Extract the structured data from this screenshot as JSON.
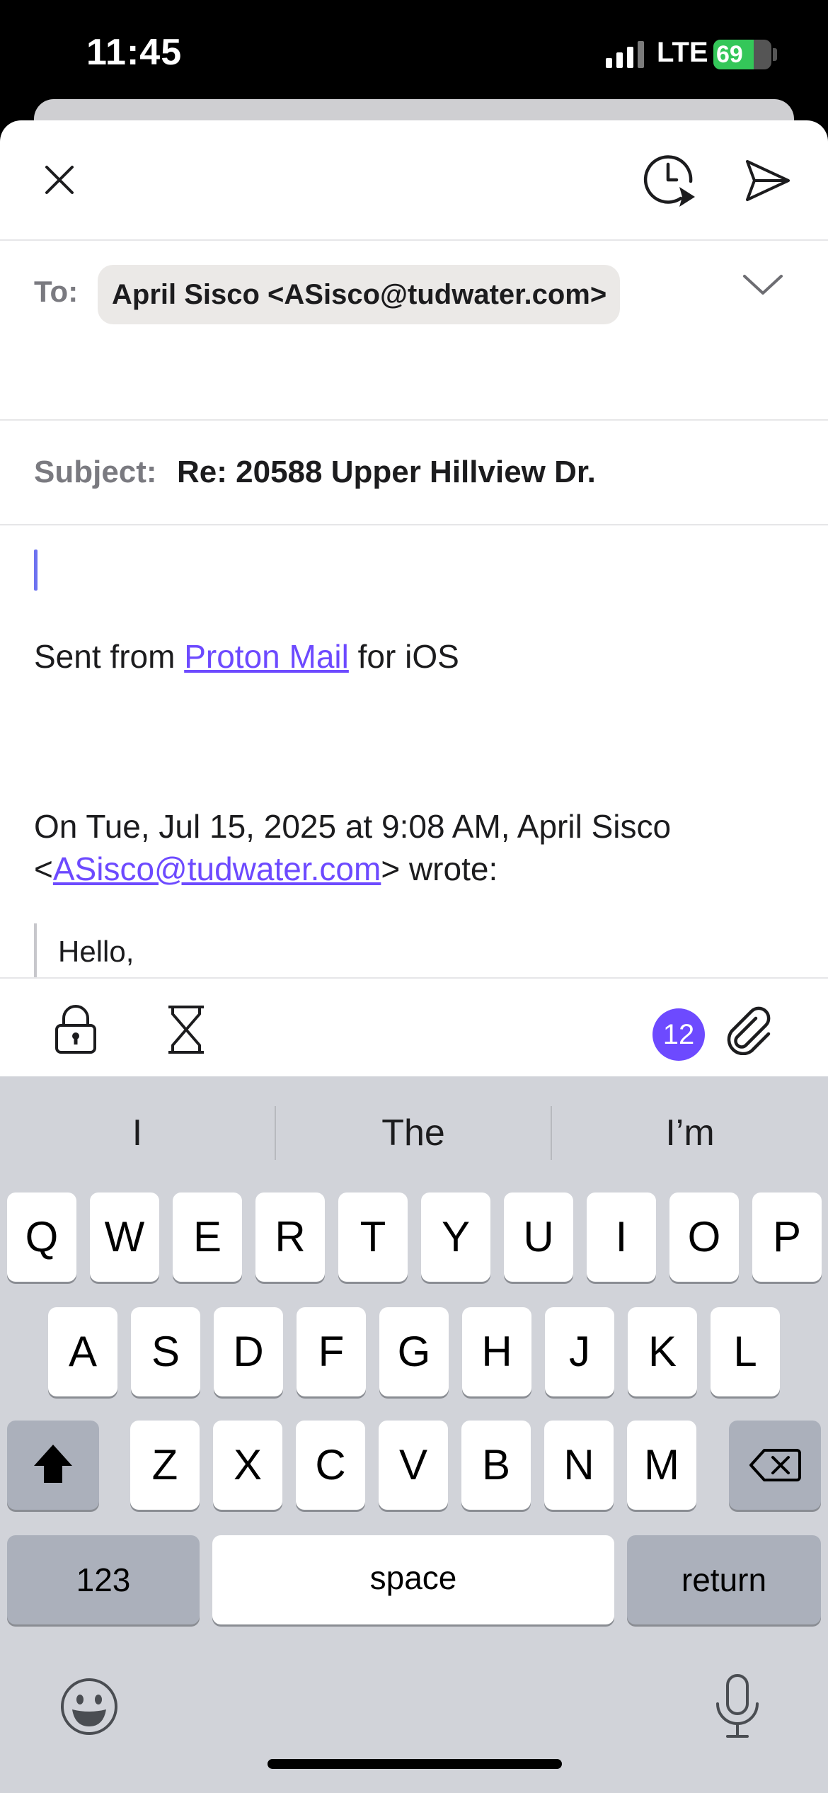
{
  "status_bar": {
    "time": "11:45",
    "network": "LTE",
    "battery": "69",
    "battery_level_percent": 69
  },
  "compose": {
    "to_label": "To:",
    "recipient": "April Sisco <ASisco@tudwater.com>",
    "subject_label": "Subject:",
    "subject": "Re: 20588 Upper Hillview Dr.",
    "signature_prefix": "Sent from ",
    "signature_link": "Proton Mail",
    "signature_suffix": " for iOS",
    "quote_header_line1": "On Tue, Jul 15, 2025 at 9:08 AM, April Sisco",
    "quote_header_lt": "<",
    "quote_header_email": "ASisco@tudwater.com",
    "quote_header_gt": "> wrote:",
    "quote_text": "Hello,",
    "attachment_count": "12"
  },
  "keyboard": {
    "suggestions": [
      "I",
      "The",
      "I’m"
    ],
    "row1": [
      "Q",
      "W",
      "E",
      "R",
      "T",
      "Y",
      "U",
      "I",
      "O",
      "P"
    ],
    "row2": [
      "A",
      "S",
      "D",
      "F",
      "G",
      "H",
      "J",
      "K",
      "L"
    ],
    "row3": [
      "Z",
      "X",
      "C",
      "V",
      "B",
      "N",
      "M"
    ],
    "numbers_key": "123",
    "space_key": "space",
    "return_key": "return"
  },
  "icons": {
    "close": "close-icon",
    "schedule_send": "schedule-send-icon",
    "send": "send-icon",
    "expand": "chevron-down-icon",
    "encrypt": "lock-icon",
    "expiration": "hourglass-icon",
    "attach": "paperclip-icon",
    "shift": "shift-icon",
    "delete": "delete-icon",
    "emoji": "emoji-icon",
    "dictation": "microphone-icon"
  },
  "colors": {
    "accent": "#6d4aff",
    "cursor": "#6d72f0",
    "battery": "#34c759",
    "keyboard_bg": "#d1d3d9"
  }
}
